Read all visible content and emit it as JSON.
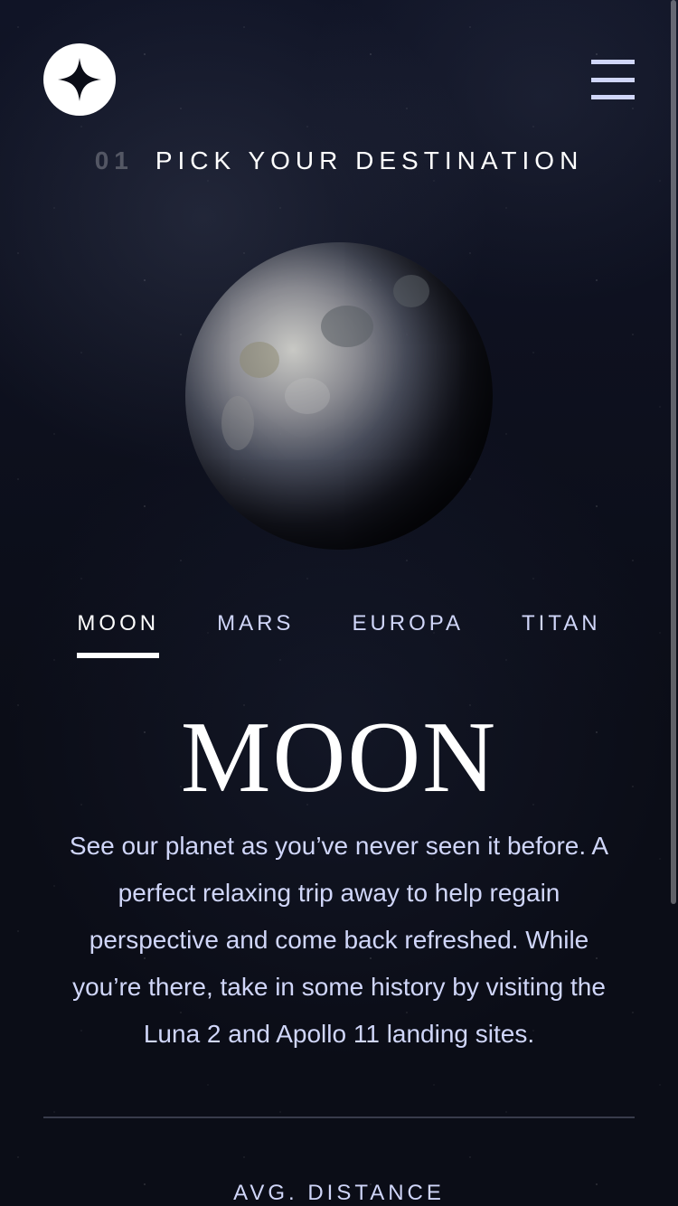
{
  "header": {
    "logo_icon": "star-logo-icon",
    "menu_icon": "hamburger-menu-icon"
  },
  "page": {
    "number": "01",
    "heading": "PICK YOUR DESTINATION"
  },
  "tabs": [
    {
      "label": "MOON",
      "active": true
    },
    {
      "label": "MARS",
      "active": false
    },
    {
      "label": "EUROPA",
      "active": false
    },
    {
      "label": "TITAN",
      "active": false
    }
  ],
  "destination": {
    "name": "MOON",
    "image": "moon-image",
    "description": "See our planet as you’ve never seen it before. A perfect relaxing trip away to help regain perspective and come back refreshed. While you’re there, take in some history by visiting the Luna 2 and Apollo 11 landing sites.",
    "stat_label": "AVG. DISTANCE"
  },
  "colors": {
    "background": "#0b0d17",
    "accent": "#d0d6f9",
    "white": "#ffffff"
  }
}
